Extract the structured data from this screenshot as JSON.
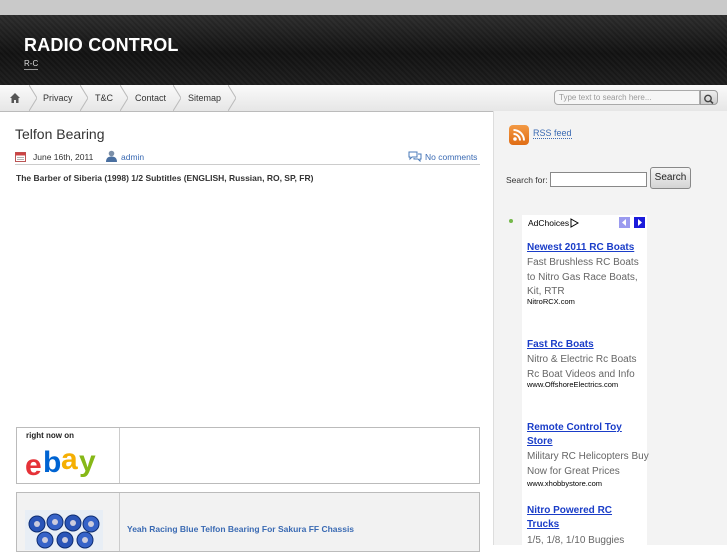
{
  "site": {
    "title": "RADIO CONTROL",
    "description": "R-C"
  },
  "nav": {
    "items": [
      "Privacy",
      "T&C",
      "Contact",
      "Sitemap"
    ]
  },
  "search_top": {
    "placeholder": "Type text to search here..."
  },
  "post": {
    "title": "Telfon Bearing",
    "date": "June 16th, 2011",
    "author": "admin",
    "comments": "No comments",
    "body": "The Barber of Siberia (1998) 1/2 Subtitles (ENGLISH, Russian, RO, SP, FR)"
  },
  "ebay_box": {
    "label": "right now on",
    "logo": "ebay"
  },
  "product": {
    "title": "Yeah Racing Blue Telfon Bearing For Sakura FF Chassis"
  },
  "sidebar": {
    "rss_label": "RSS feed",
    "search_label": "Search for:",
    "search_button": "Search"
  },
  "ads": {
    "choices_label": "AdChoices",
    "items": [
      {
        "title": "Newest 2011 RC Boats",
        "desc": "Fast Brushless RC Boats to Nitro Gas Race Boats, Kit, RTR",
        "url": "NitroRCX.com"
      },
      {
        "title": "Fast Rc Boats",
        "desc": "Nitro & Electric Rc Boats Rc Boat Videos and Info",
        "url": "www.OffshoreElectrics.com"
      },
      {
        "title": "Remote Control Toy Store",
        "desc": "Military RC Helicopters Buy Now for Great Prices",
        "url": "www.xhobbystore.com"
      },
      {
        "title": "Nitro Powered RC Trucks",
        "desc": "1/5, 1/8, 1/10 Buggies",
        "url": ""
      }
    ]
  },
  "colors": {
    "link": "#3a6ab3",
    "ad_link": "#1a3dc8",
    "rss": "#e67a22"
  }
}
